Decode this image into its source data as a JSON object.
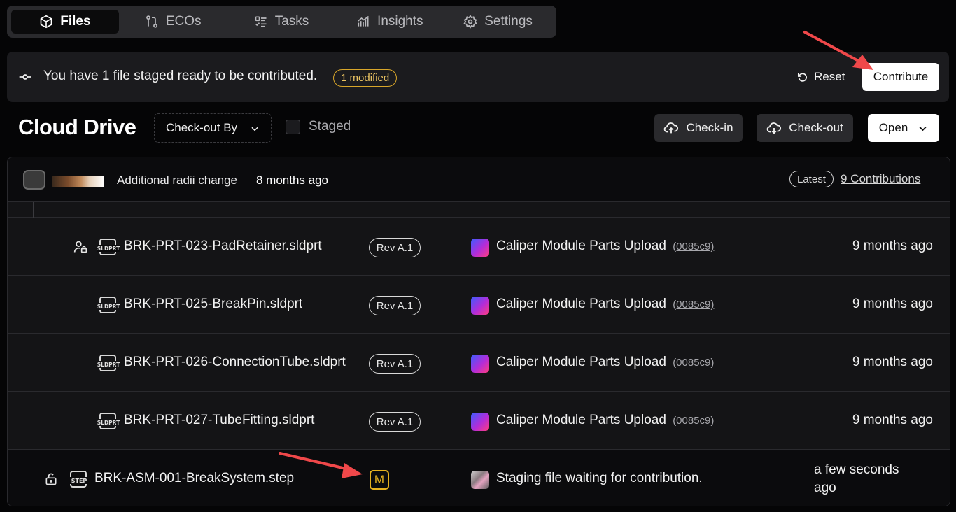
{
  "tabs": [
    {
      "label": "Files",
      "icon": "cube-icon",
      "active": true
    },
    {
      "label": "ECOs",
      "icon": "git-compare-icon",
      "active": false
    },
    {
      "label": "Tasks",
      "icon": "task-list-icon",
      "active": false
    },
    {
      "label": "Insights",
      "icon": "chart-icon",
      "active": false
    },
    {
      "label": "Settings",
      "icon": "gear-icon",
      "active": false
    }
  ],
  "banner": {
    "message": "You have 1 file staged ready to be contributed.",
    "badge": "1 modified",
    "reset_label": "Reset",
    "contribute_label": "Contribute"
  },
  "header": {
    "title": "Cloud Drive",
    "filter_label": "Check-out By",
    "staged_label": "Staged",
    "checkin_label": "Check-in",
    "checkout_label": "Check-out",
    "open_label": "Open"
  },
  "commit": {
    "message": "Additional radii change",
    "time": "8 months ago",
    "latest_label": "Latest",
    "contributions_label": "9 Contributions"
  },
  "files": [
    {
      "name": "BRK-PRT-023-PadRetainer.sldprt",
      "type": "SLDPRT",
      "rev": "Rev A.1",
      "project": "Caliper Module Parts Upload",
      "hash": "(0085c9)",
      "time": "9 months ago"
    },
    {
      "name": "BRK-PRT-025-BreakPin.sldprt",
      "type": "SLDPRT",
      "rev": "Rev A.1",
      "project": "Caliper Module Parts Upload",
      "hash": "(0085c9)",
      "time": "9 months ago"
    },
    {
      "name": "BRK-PRT-026-ConnectionTube.sldprt",
      "type": "SLDPRT",
      "rev": "Rev A.1",
      "project": "Caliper Module Parts Upload",
      "hash": "(0085c9)",
      "time": "9 months ago"
    },
    {
      "name": "BRK-PRT-027-TubeFitting.sldprt",
      "type": "SLDPRT",
      "rev": "Rev A.1",
      "project": "Caliper Module Parts Upload",
      "hash": "(0085c9)",
      "time": "9 months ago"
    }
  ],
  "staged_file": {
    "name": "BRK-ASM-001-BreakSystem.step",
    "type": "STEP",
    "status": "M",
    "project": "Staging file waiting for contribution.",
    "time": "a few seconds ago"
  },
  "colors": {
    "accent_modified": "#e7b21f",
    "arrow": "#f0484a"
  }
}
